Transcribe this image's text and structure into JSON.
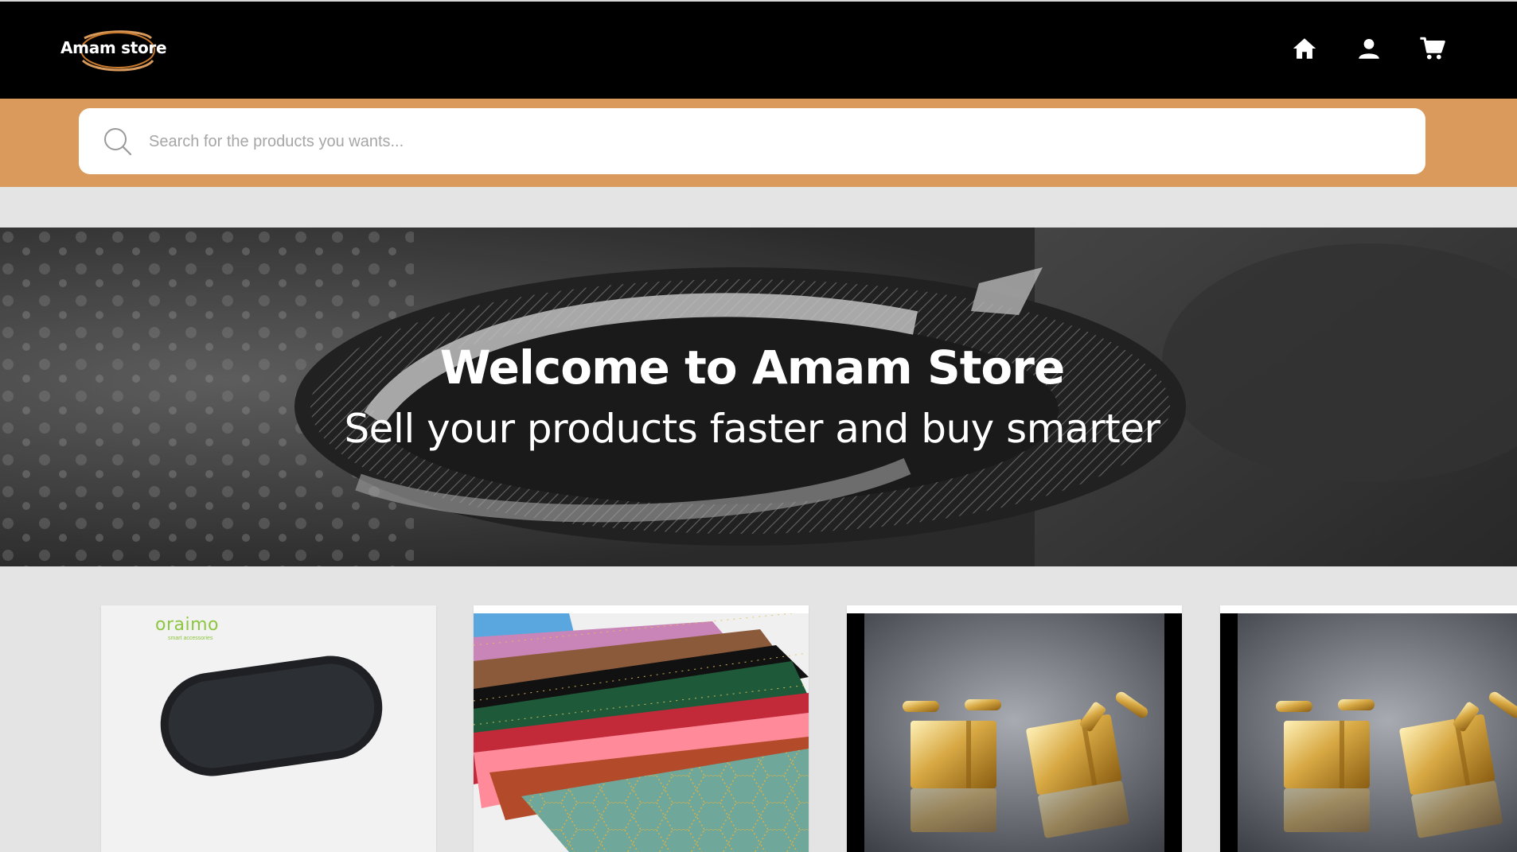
{
  "header": {
    "logo_text": "Amam store",
    "icons": [
      "home-icon",
      "user-icon",
      "cart-icon"
    ]
  },
  "search": {
    "placeholder": "Search for the products you wants..."
  },
  "hero": {
    "title": "Welcome to Amam Store",
    "subtitle": "Sell your products faster and buy smarter"
  },
  "products": [
    {
      "image": "speaker",
      "brand_text": "oraimo",
      "brand_tagline": "smart accessories"
    },
    {
      "image": "fabric-stack"
    },
    {
      "image": "gold-cufflinks"
    },
    {
      "image": "gold-cufflinks"
    }
  ],
  "colors": {
    "header_bg": "#000000",
    "accent": "#d99a5b",
    "page_bg": "#e4e4e4",
    "oraimo_green": "#8dc63f"
  }
}
